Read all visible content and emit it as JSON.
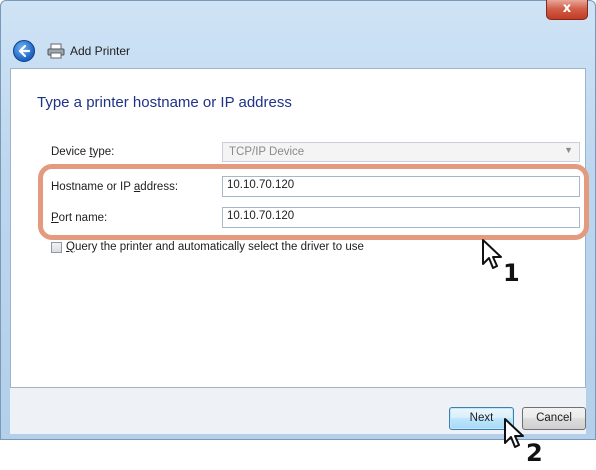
{
  "window": {
    "title": "Add Printer",
    "close_label": "x"
  },
  "main": {
    "heading": "Type a printer hostname or IP address",
    "device_type": {
      "label_pre": "Device ",
      "label_ul": "t",
      "label_post": "ype:",
      "value": "TCP/IP Device"
    },
    "hostname": {
      "label_pre": "Hostname or IP ",
      "label_ul": "a",
      "label_post": "ddress:",
      "value": "10.10.70.120"
    },
    "port": {
      "label_pre": "",
      "label_ul": "P",
      "label_post": "ort name:",
      "value": "10.10.70.120"
    },
    "query_checkbox": {
      "label_pre": "",
      "label_ul": "Q",
      "label_post": "uery the printer and automatically select the driver to use",
      "checked": false
    }
  },
  "buttons": {
    "next": "Next",
    "cancel": "Cancel"
  },
  "callouts": {
    "step1": "1",
    "step2": "2"
  }
}
